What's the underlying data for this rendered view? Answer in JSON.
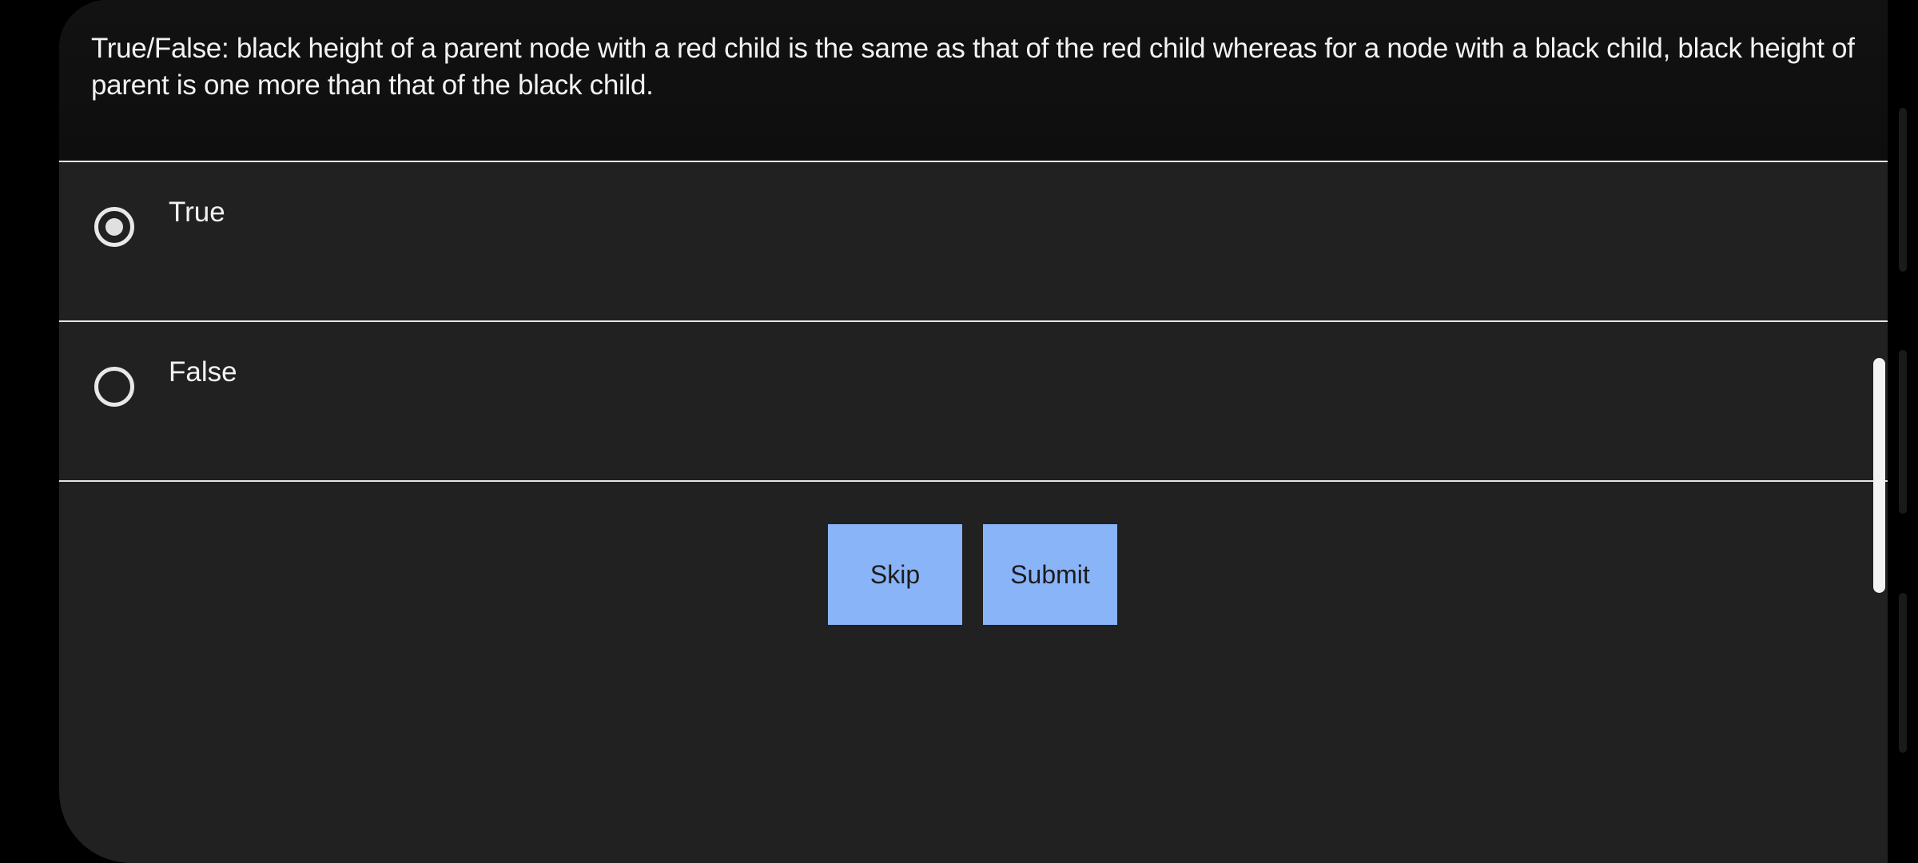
{
  "question": {
    "text": "True/False: black height of a parent node with a red child is the same as that of the red child whereas for a node with a black child, black height of parent is one more than that of the black child."
  },
  "options": [
    {
      "label": "True",
      "selected": true
    },
    {
      "label": "False",
      "selected": false
    }
  ],
  "actions": {
    "skip_label": "Skip",
    "submit_label": "Submit"
  },
  "colors": {
    "button_bg": "#8ab4f8",
    "panel_bg": "#212121",
    "question_bg": "#101010"
  },
  "icons": {
    "selected_radio": "radio-checked-icon",
    "unselected_radio": "radio-unchecked-icon"
  }
}
